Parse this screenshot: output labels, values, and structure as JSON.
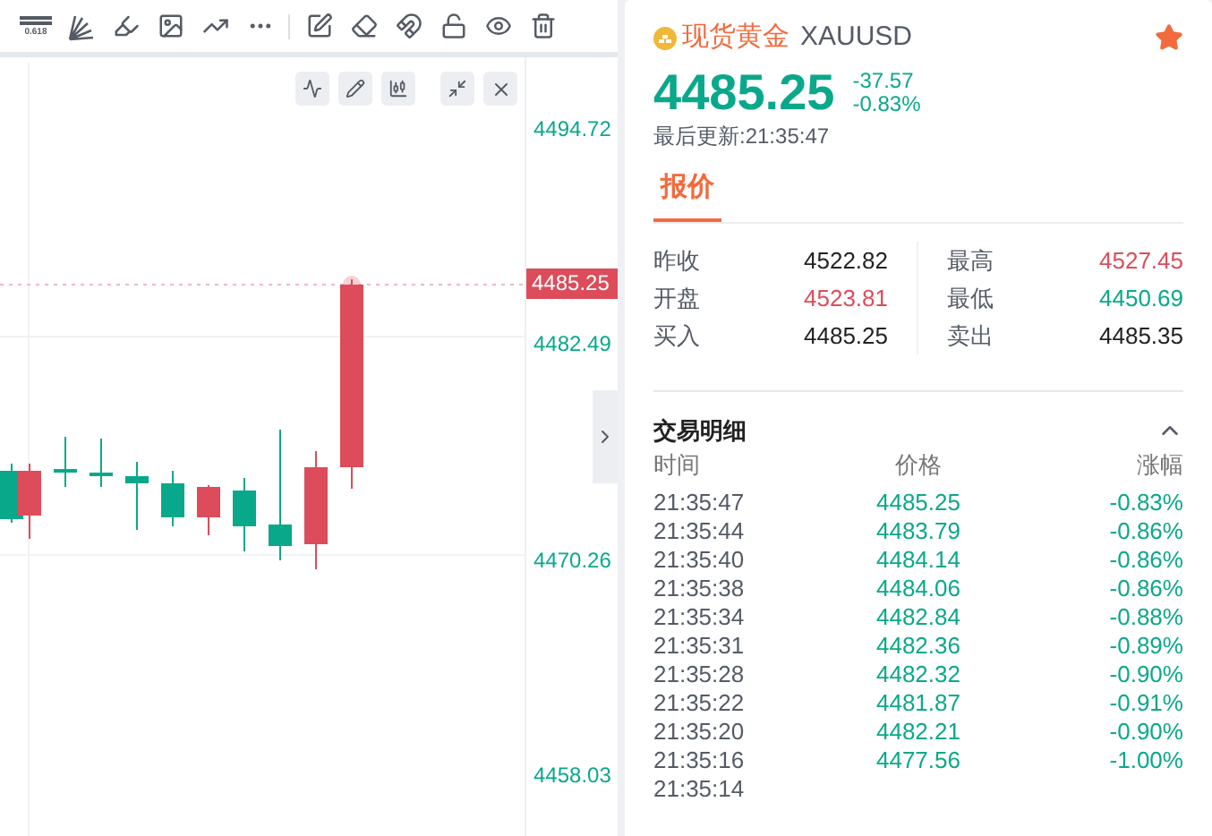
{
  "toolbar": {
    "fib_label": "0.618"
  },
  "axis": {
    "labels": [
      "4494.72",
      "4482.49",
      "4470.26",
      "4458.03"
    ],
    "current_price": "4485.25"
  },
  "header": {
    "name": "现货黄金",
    "symbol": "XAUUSD",
    "favorite": true,
    "price": "4485.25",
    "change": "-37.57",
    "change_pct": "-0.83%",
    "updated": "最后更新:21:35:47"
  },
  "tabs": [
    {
      "label": "报价",
      "selected": true
    }
  ],
  "quote": [
    {
      "label": "昨收",
      "value": "4522.82",
      "color": "#222222"
    },
    {
      "label": "最高",
      "value": "4527.45",
      "color": "#dc4c5a"
    },
    {
      "label": "开盘",
      "value": "4523.81",
      "color": "#dc4c5a"
    },
    {
      "label": "最低",
      "value": "4450.69",
      "color": "#0aa88a"
    },
    {
      "label": "买入",
      "value": "4485.25",
      "color": "#222222"
    },
    {
      "label": "卖出",
      "value": "4485.35",
      "color": "#222222"
    }
  ],
  "trades": {
    "title": "交易明细",
    "expanded": true,
    "columns": [
      "时间",
      "价格",
      "涨幅"
    ],
    "rows": [
      {
        "time": "21:35:47",
        "price": "4485.25",
        "change": "-0.83%"
      },
      {
        "time": "21:35:44",
        "price": "4483.79",
        "change": "-0.86%"
      },
      {
        "time": "21:35:40",
        "price": "4484.14",
        "change": "-0.86%"
      },
      {
        "time": "21:35:38",
        "price": "4484.06",
        "change": "-0.86%"
      },
      {
        "time": "21:35:34",
        "price": "4482.84",
        "change": "-0.88%"
      },
      {
        "time": "21:35:31",
        "price": "4482.36",
        "change": "-0.89%"
      },
      {
        "time": "21:35:28",
        "price": "4482.32",
        "change": "-0.90%"
      },
      {
        "time": "21:35:22",
        "price": "4481.87",
        "change": "-0.91%"
      },
      {
        "time": "21:35:20",
        "price": "4482.21",
        "change": "-0.90%"
      },
      {
        "time": "21:35:16",
        "price": "4477.56",
        "change": "-1.00%"
      },
      {
        "time": "21:35:14"
      }
    ]
  }
}
